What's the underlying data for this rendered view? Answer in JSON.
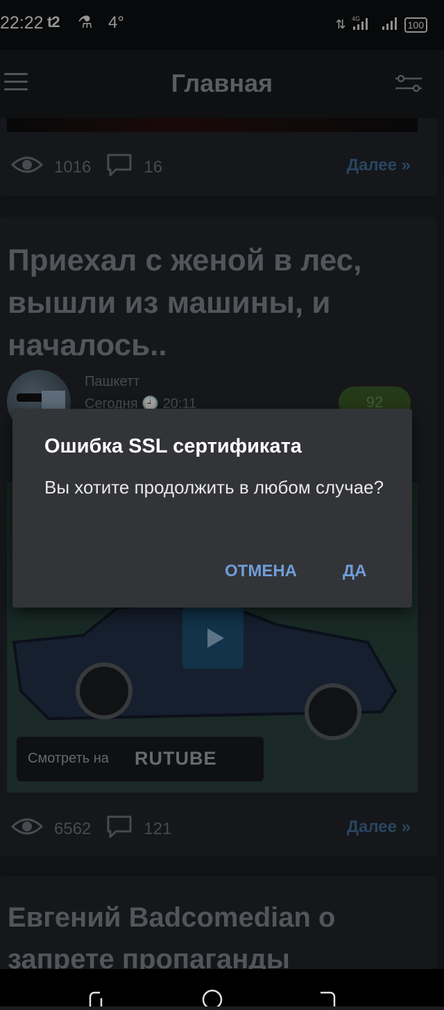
{
  "status_bar": {
    "time": "22:22",
    "carrier_logo": "t2",
    "temperature": "4°",
    "network": "4G",
    "battery": "100"
  },
  "header": {
    "title": "Главная"
  },
  "prev_card": {
    "views": "1016",
    "comments": "16",
    "more": "Далее »"
  },
  "post": {
    "title": "Приехал с женой в лес, вышли из машины, и началось..",
    "author": "Пашкетт",
    "date_prefix": "Сегодня",
    "time": "20:11",
    "rating": "92",
    "video_badge_prefix": "Смотреть на",
    "video_badge_brand": "RUTUBE",
    "views": "6562",
    "comments": "121",
    "more": "Далее »"
  },
  "next_card": {
    "title": "Евгений Badcomedian о запрете пропаганды"
  },
  "dialog": {
    "title": "Ошибка SSL сертификата",
    "message": "Вы хотите продолжить в любом случае?",
    "cancel": "ОТМЕНА",
    "confirm": "ДА"
  },
  "colors": {
    "background": "#1b1d21",
    "card": "#222428",
    "accent_link": "#3e6a95",
    "dialog": "#333438",
    "dialog_button": "#6f9ed8",
    "rating": "#3a5a26"
  }
}
